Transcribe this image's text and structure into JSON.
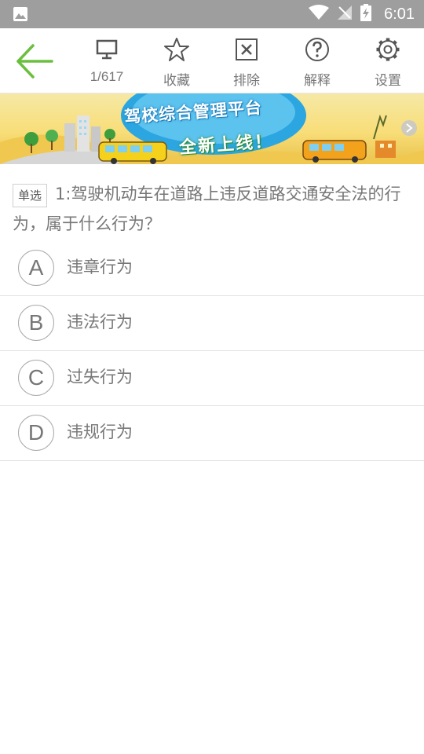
{
  "status_bar": {
    "time": "6:01"
  },
  "toolbar": {
    "items": [
      {
        "label": "1/617",
        "icon": "monitor-icon"
      },
      {
        "label": "收藏",
        "icon": "star-icon"
      },
      {
        "label": "排除",
        "icon": "x-box-icon"
      },
      {
        "label": "解释",
        "icon": "help-icon"
      },
      {
        "label": "设置",
        "icon": "gear-icon"
      }
    ],
    "accent": "#6bbf3f"
  },
  "banner": {
    "title": "驾校综合管理平台",
    "subtitle": "全新上线！"
  },
  "question": {
    "tag": "单选",
    "text": "1:驾驶机动车在道路上违反道路交通安全法的行为，属于什么行为？"
  },
  "options": [
    {
      "letter": "A",
      "text": "违章行为"
    },
    {
      "letter": "B",
      "text": "违法行为"
    },
    {
      "letter": "C",
      "text": "过失行为"
    },
    {
      "letter": "D",
      "text": "违规行为"
    }
  ]
}
